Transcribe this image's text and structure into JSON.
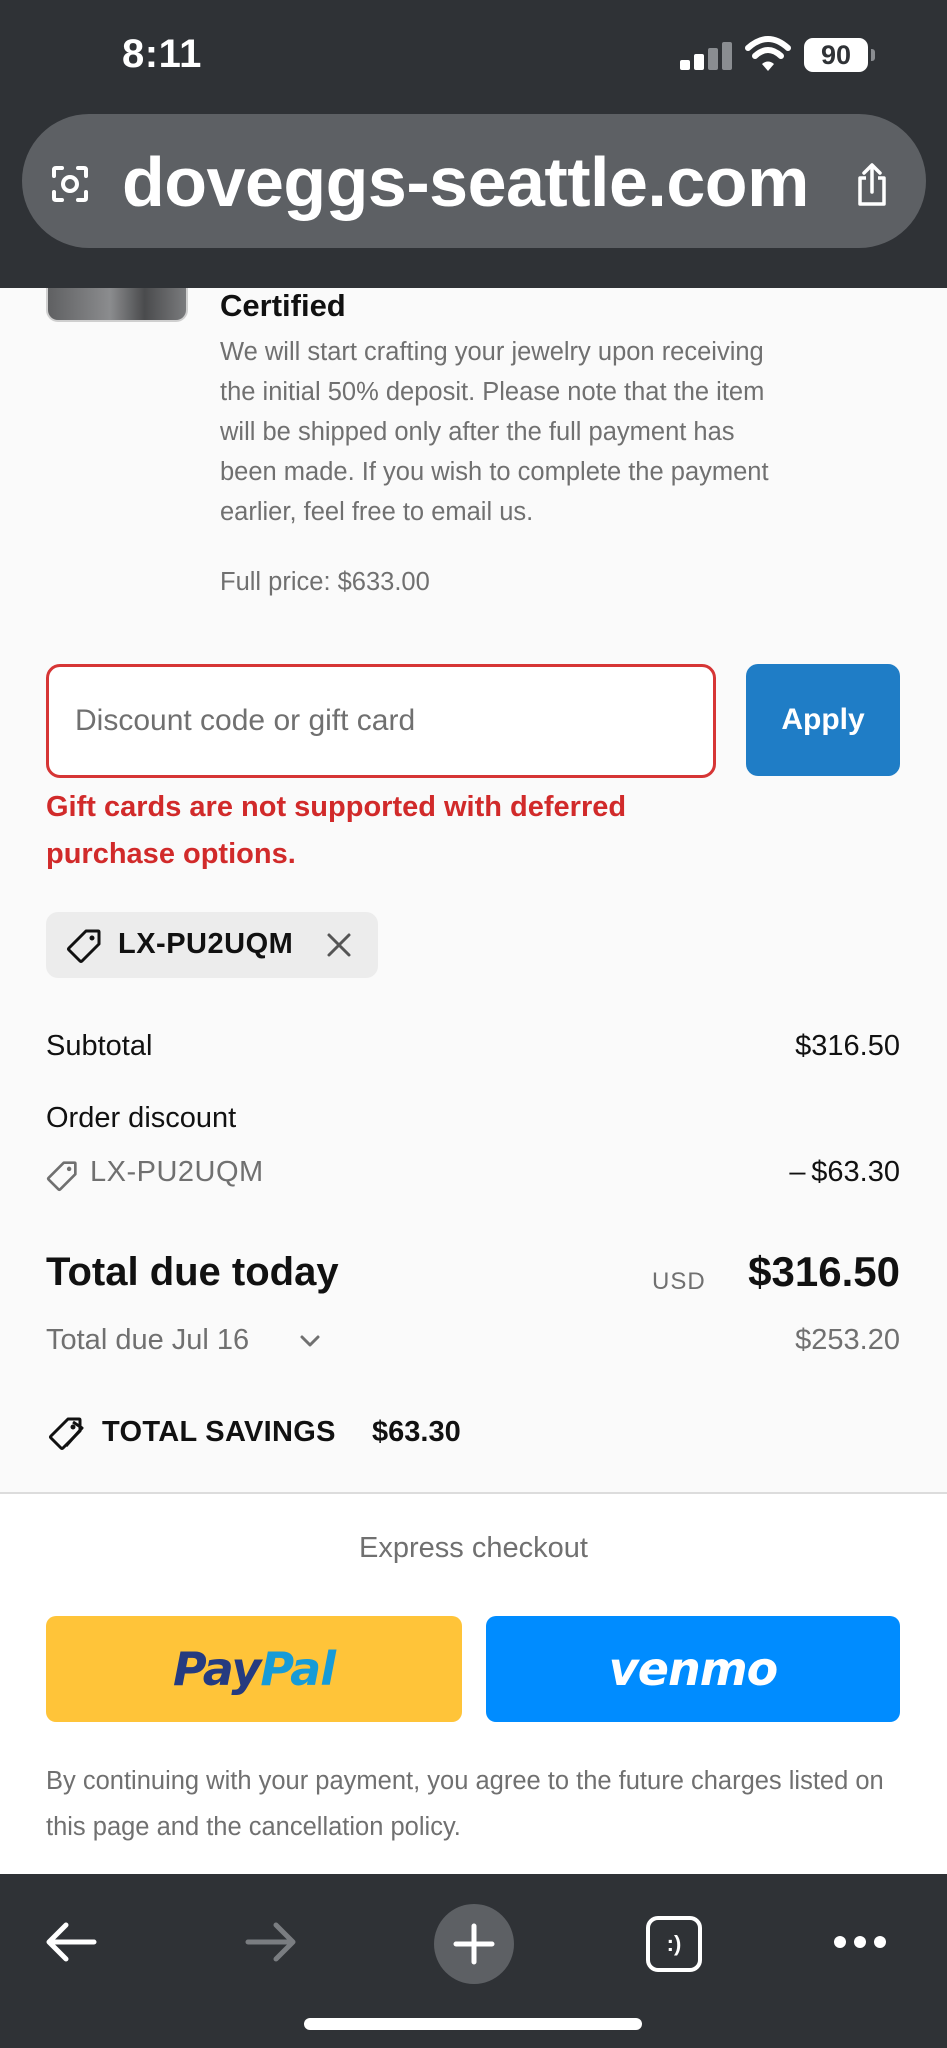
{
  "status_bar": {
    "time": "8:11",
    "battery": "90"
  },
  "browser": {
    "url": "doveggs-seattle.com"
  },
  "product": {
    "certified_label": "Certified",
    "description": "We will start crafting your jewelry upon receiving the initial 50% deposit. Please note that the item will be shipped only after the full payment has been made. If you wish to complete the payment earlier, feel free to email us.",
    "full_price": "Full price: $633.00"
  },
  "discount": {
    "placeholder": "Discount code or gift card",
    "value": "",
    "apply_label": "Apply",
    "error": "Gift cards are not supported with deferred purchase options.",
    "applied_code": "LX-PU2UQM"
  },
  "summary": {
    "subtotal_label": "Subtotal",
    "subtotal_value": "$316.50",
    "order_discount_label": "Order discount",
    "discount_code": "LX-PU2UQM",
    "discount_value": "– $63.30",
    "total_label": "Total due today",
    "currency": "USD",
    "total_value": "$316.50",
    "due_later_label": "Total due Jul 16",
    "due_later_value": "$253.20",
    "savings_label": "TOTAL SAVINGS",
    "savings_value": "$63.30"
  },
  "express": {
    "title": "Express checkout",
    "paypal_part1": "Pay",
    "paypal_part2": "Pal",
    "venmo_label": "venmo",
    "legal": "By continuing with your payment, you agree to the future charges listed on this page and the cancellation policy."
  },
  "toolbar": {
    "tabs_glyph": ":)"
  },
  "colors": {
    "chrome": "#2f3236",
    "error": "#d12a2a",
    "apply": "#1f7dc6",
    "paypal": "#ffc439",
    "venmo": "#008cff"
  },
  "icons": [
    "lens-icon",
    "share-icon",
    "tag-icon",
    "close-icon",
    "chevron-down-icon",
    "savings-tag-icon",
    "back-arrow-icon",
    "forward-arrow-icon",
    "plus-icon",
    "more-icon"
  ]
}
